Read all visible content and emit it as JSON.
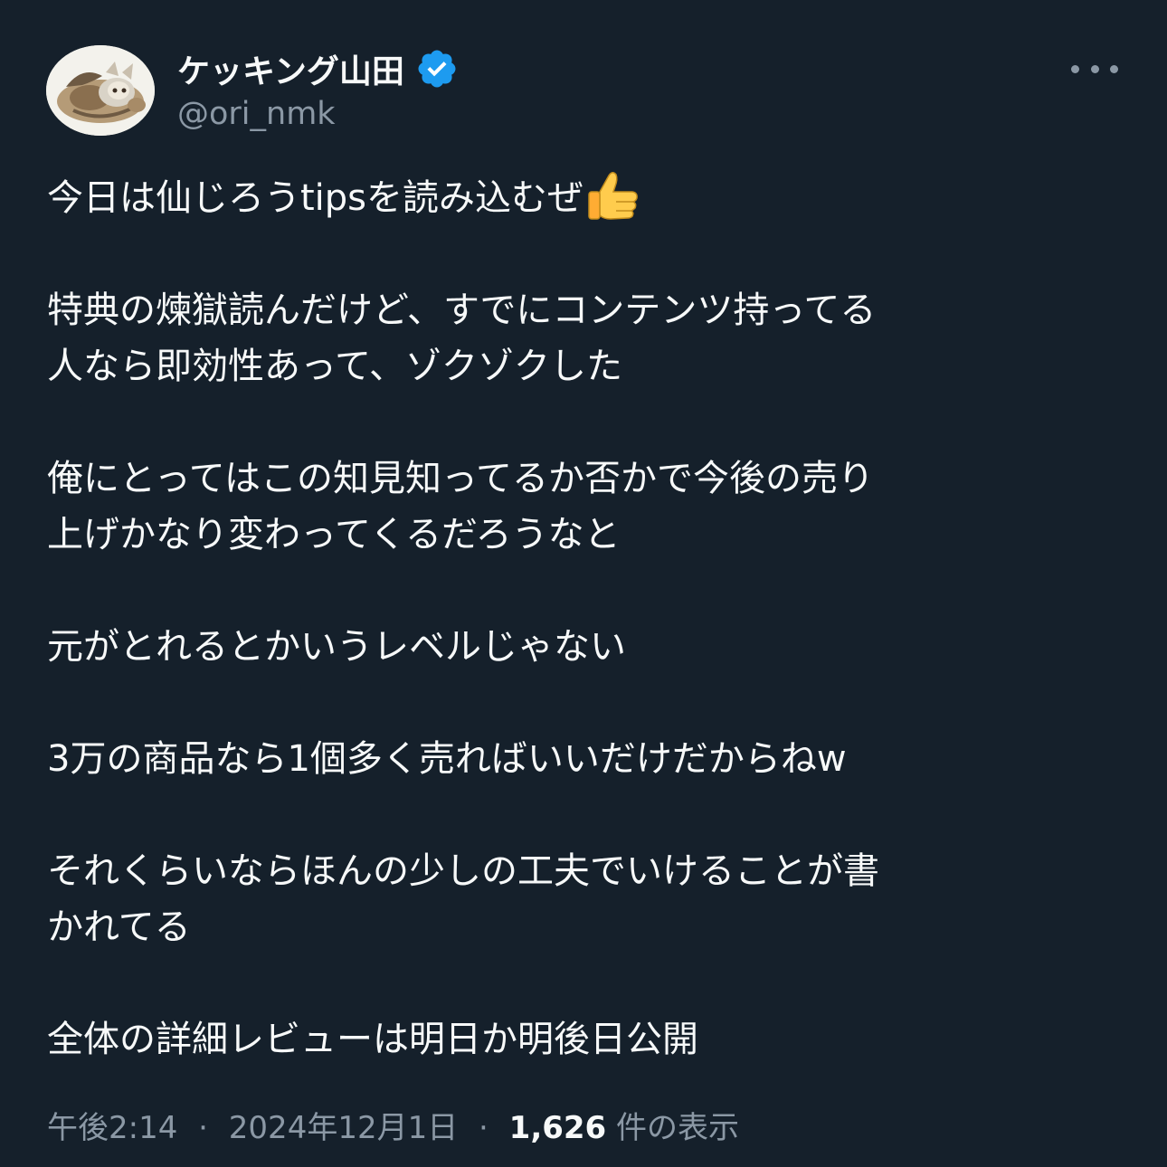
{
  "author": {
    "display_name": "ケッキング山田",
    "handle": "@ori_nmk",
    "verified": true,
    "avatar_icon": "slaking-avatar-icon"
  },
  "tweet": {
    "paragraphs": [
      {
        "lines": [
          "今日は仙じろうtipsを読み込むぜ"
        ],
        "emoji": "thumbs-up-icon"
      },
      {
        "lines": [
          "特典の煉獄読んだけど、すでにコンテンツ持ってる",
          "人なら即効性あって、ゾクゾクした"
        ]
      },
      {
        "lines": [
          "俺にとってはこの知見知ってるか否かで今後の売り",
          "上げかなり変わってくるだろうなと"
        ]
      },
      {
        "lines": [
          "元がとれるとかいうレベルじゃない"
        ]
      },
      {
        "lines": [
          "3万の商品なら1個多く売ればいいだけだからねw"
        ]
      },
      {
        "lines": [
          "それくらいならほんの少しの工夫でいけることが書",
          "かれてる"
        ]
      },
      {
        "lines": [
          "全体の詳細レビューは明日か明後日公開"
        ]
      }
    ]
  },
  "meta": {
    "time": "午後2:14",
    "separator": "·",
    "date": "2024年12月1日",
    "views_count": "1,626",
    "views_label": "件の表示"
  },
  "colors": {
    "background": "#15202b",
    "text": "#f7f9f9",
    "secondary": "#8b98a5",
    "verified": "#1d9bf0"
  },
  "icons": {
    "more": "more-options-icon",
    "verified": "verified-badge-icon"
  }
}
